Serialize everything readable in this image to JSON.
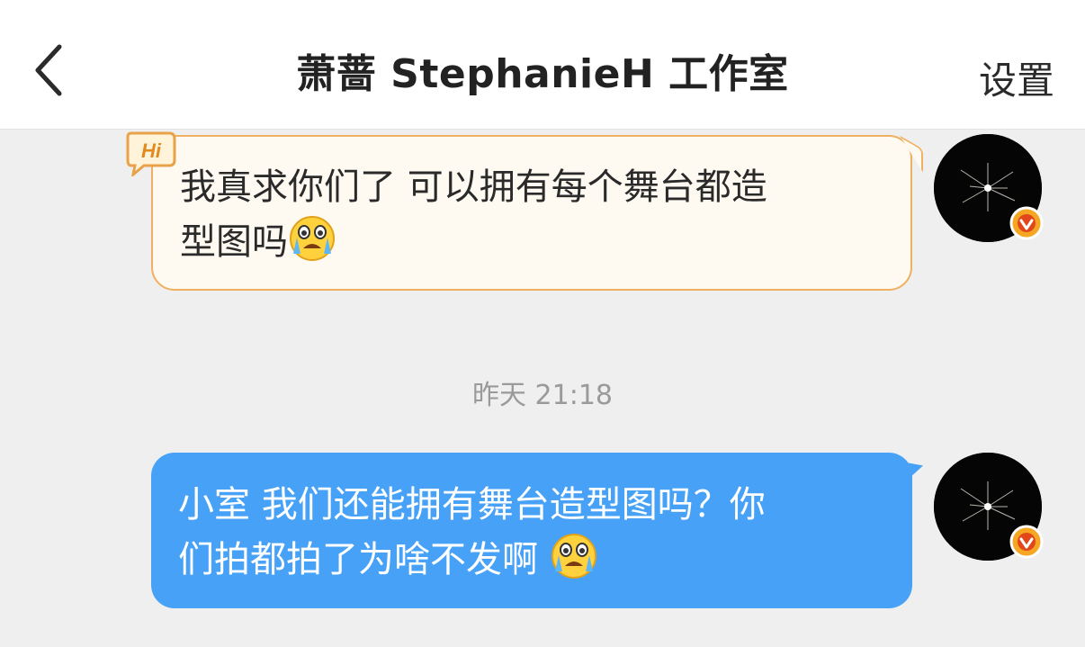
{
  "header": {
    "title": "萧蔷 StephanieH 工作室",
    "settings_label": "设置",
    "back_icon": "chevron-left-icon"
  },
  "messages": [
    {
      "line1": "我真求你们了 可以拥有每个舞台都造",
      "line2": "型图吗",
      "emoji": "crying-face-icon",
      "style": "hi-bubble",
      "badge": "Hi"
    },
    {
      "line1": "小室 我们还能拥有舞台造型图吗？你",
      "line2": "们拍都拍了为啥不发啊 ",
      "emoji": "crying-face-icon",
      "style": "blue-bubble"
    }
  ],
  "timestamp": "昨天 21:18",
  "colors": {
    "header_bg": "#ffffff",
    "chat_bg": "#efefef",
    "hi_bubble_bg": "#fffaf1",
    "hi_bubble_border": "#efb061",
    "blue_bubble_bg": "#47a2f7",
    "verified_badge": "#f5a623"
  }
}
